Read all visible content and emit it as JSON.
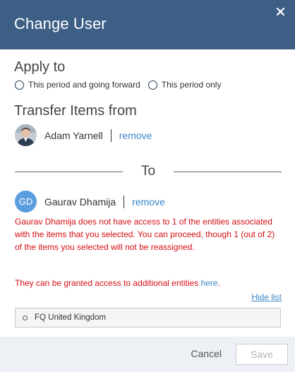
{
  "dialog": {
    "title": "Change User",
    "colors": {
      "header": "#3d5f86",
      "link": "#3a86c8",
      "warning": "#d40d12",
      "avatar": "#5b9ddf"
    }
  },
  "apply_to": {
    "heading": "Apply to",
    "options": [
      {
        "label": "This period and going forward",
        "selected": false
      },
      {
        "label": "This period only",
        "selected": false
      }
    ]
  },
  "transfer_from": {
    "heading": "Transfer Items from",
    "user_name": "Adam Yarnell",
    "remove_label": "remove"
  },
  "divider_label": "To",
  "transfer_to": {
    "initials": "GD",
    "user_name": "Gaurav Dhamija",
    "remove_label": "remove"
  },
  "warning": {
    "message": "Gaurav Dhamija does not have access to 1 of the entities associated with the items that you selected. You can proceed, though 1 (out of 2) of the items you selected will not be reassigned.",
    "access_prefix": "They can be granted access to additional entities ",
    "access_link": "here",
    "access_suffix": "."
  },
  "entity_list": {
    "toggle_label": "Hide list",
    "items": [
      "FQ United Kingdom"
    ]
  },
  "footer": {
    "cancel_label": "Cancel",
    "save_label": "Save"
  }
}
